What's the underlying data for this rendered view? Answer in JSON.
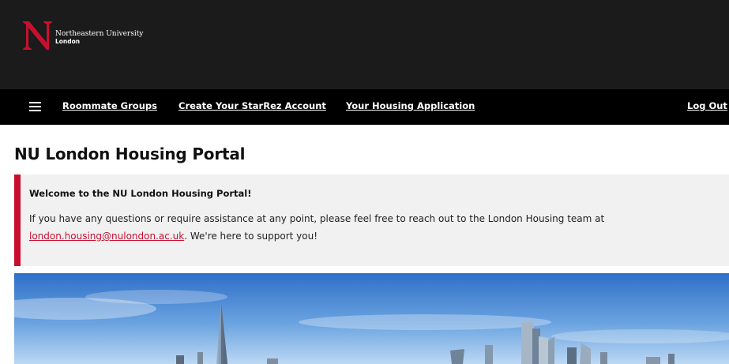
{
  "logo": {
    "line1": "Northeastern University",
    "line2": "London",
    "letter": "N"
  },
  "nav": {
    "menu_icon": "hamburger-menu-icon",
    "links": [
      {
        "label": "Roommate Groups"
      },
      {
        "label": "Create Your StarRez Account"
      },
      {
        "label": "Your Housing Application"
      }
    ],
    "logout_label": "Log Out"
  },
  "page": {
    "title": "NU London Housing Portal"
  },
  "welcome": {
    "heading": "Welcome to the NU London Housing Portal!",
    "body_before": "If you have any questions or require assistance at any point, please feel free to reach out to the London Housing team at ",
    "email": "london.housing@nulondon.ac.uk",
    "body_after": ". We're here to support you!"
  },
  "hero": {
    "image": "london-skyline-photo"
  },
  "colors": {
    "header_bg": "#1b1b1b",
    "nav_bg": "#000000",
    "accent": "#c8102e",
    "callout_bg": "#f1f1f1"
  }
}
